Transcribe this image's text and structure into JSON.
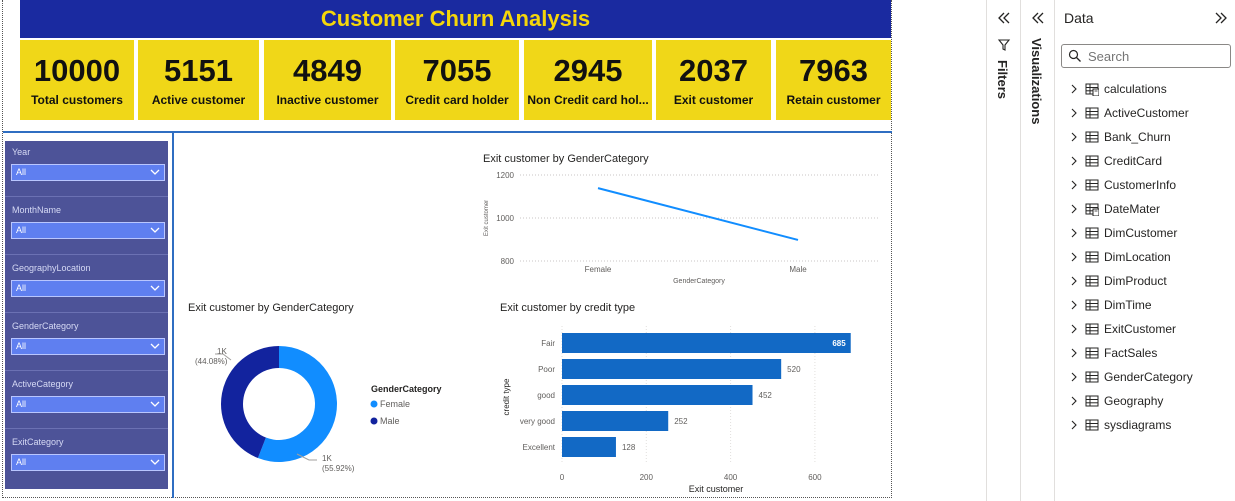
{
  "report": {
    "title": "Customer Churn Analysis",
    "kpis": [
      {
        "value": "10000",
        "label": "Total customers"
      },
      {
        "value": "5151",
        "label": "Active customer"
      },
      {
        "value": "4849",
        "label": "Inactive customer"
      },
      {
        "value": "7055",
        "label": "Credit card holder"
      },
      {
        "value": "2945",
        "label": "Non Credit card hol..."
      },
      {
        "value": "2037",
        "label": "Exit customer"
      },
      {
        "value": "7963",
        "label": "Retain customer"
      }
    ],
    "slicers": [
      {
        "title": "Year",
        "value": "All"
      },
      {
        "title": "MonthName",
        "value": "All"
      },
      {
        "title": "GeographyLocation",
        "value": "All"
      },
      {
        "title": "GenderCategory",
        "value": "All"
      },
      {
        "title": "ActiveCategory",
        "value": "All"
      },
      {
        "title": "ExitCategory",
        "value": "All"
      }
    ]
  },
  "chart_data": [
    {
      "type": "line",
      "title": "Exit customer by GenderCategory",
      "xlabel": "GenderCategory",
      "ylabel": "Exit customer",
      "categories": [
        "Female",
        "Male"
      ],
      "values": [
        1139,
        898
      ],
      "ylim": [
        800,
        1200
      ],
      "yticks": [
        "800",
        "1000",
        "1200"
      ],
      "grid": true,
      "color": "#118dff"
    },
    {
      "type": "pie",
      "title": "Exit customer by GenderCategory",
      "legend_title": "GenderCategory",
      "legend_placement": "right",
      "slices": [
        {
          "name": "Female",
          "value": 55.92,
          "label": "1K",
          "pct": "(55.92%)",
          "color": "#118dff"
        },
        {
          "name": "Male",
          "value": 44.08,
          "label": "1K",
          "pct": "(44.08%)",
          "color": "#12239e"
        }
      ]
    },
    {
      "type": "bar",
      "orientation": "horizontal",
      "title": "Exit customer by credit type",
      "xlabel": "Exit customer",
      "ylabel": "credit type",
      "categories": [
        "Fair",
        "Poor",
        "good",
        "very good",
        "Excellent"
      ],
      "values": [
        685,
        520,
        452,
        252,
        128
      ],
      "xlim": [
        0,
        700
      ],
      "xticks": [
        "0",
        "200",
        "400",
        "600"
      ],
      "color": "#1269c5"
    }
  ],
  "panes": {
    "filters": "Filters",
    "visualizations": "Visualizations",
    "data": {
      "title": "Data",
      "search_placeholder": "Search",
      "tables": [
        {
          "name": "calculations",
          "icon": "calc-table-icon"
        },
        {
          "name": "ActiveCustomer",
          "icon": "table-icon"
        },
        {
          "name": "Bank_Churn",
          "icon": "table-icon"
        },
        {
          "name": "CreditCard",
          "icon": "table-icon"
        },
        {
          "name": "CustomerInfo",
          "icon": "table-icon"
        },
        {
          "name": "DateMater",
          "icon": "calc-table-icon"
        },
        {
          "name": "DimCustomer",
          "icon": "table-icon"
        },
        {
          "name": "DimLocation",
          "icon": "table-icon"
        },
        {
          "name": "DimProduct",
          "icon": "table-icon"
        },
        {
          "name": "DimTime",
          "icon": "table-icon"
        },
        {
          "name": "ExitCustomer",
          "icon": "table-icon"
        },
        {
          "name": "FactSales",
          "icon": "table-icon"
        },
        {
          "name": "GenderCategory",
          "icon": "table-icon"
        },
        {
          "name": "Geography",
          "icon": "table-icon"
        },
        {
          "name": "sysdiagrams",
          "icon": "table-icon"
        }
      ]
    }
  }
}
